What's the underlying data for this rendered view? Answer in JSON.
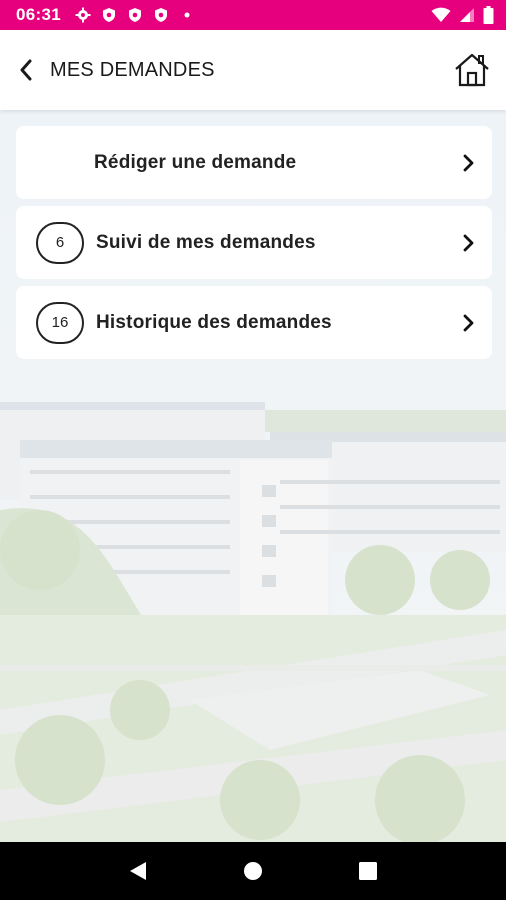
{
  "status_bar": {
    "time": "06:31",
    "left_icons": [
      "gear-icon",
      "shield-icon",
      "shield-icon",
      "shield-icon",
      "dot-icon"
    ],
    "right_icons": [
      "wifi-icon",
      "signal-icon",
      "battery-icon"
    ],
    "color": "#e6007e"
  },
  "app_bar": {
    "title": "MES DEMANDES",
    "back_icon": "chevron-left-icon",
    "home_icon": "home-icon"
  },
  "menu": {
    "items": [
      {
        "label": "Rédiger une demande",
        "count": null
      },
      {
        "label": "Suivi de mes demandes",
        "count": "6"
      },
      {
        "label": "Historique des demandes",
        "count": "16"
      }
    ]
  },
  "nav_bar": {
    "buttons": [
      "back-triangle-icon",
      "home-circle-icon",
      "recents-square-icon"
    ]
  }
}
